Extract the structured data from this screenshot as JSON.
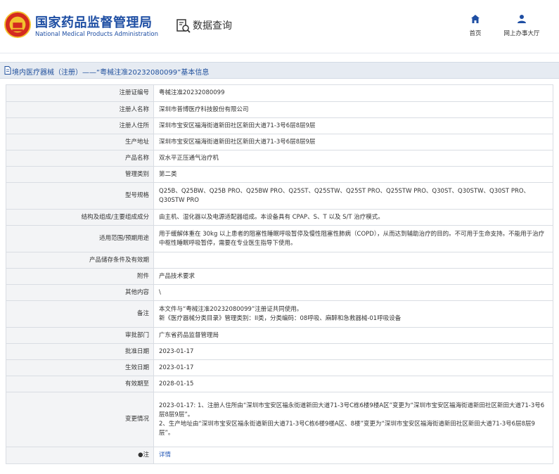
{
  "header": {
    "site_title_cn": "国家药品监督管理局",
    "site_title_en": "National Medical Products Administration",
    "query_title": "数据查询",
    "nav": [
      {
        "label": "首页",
        "icon": "home-icon"
      },
      {
        "label": "网上办事大厅",
        "icon": "user-icon"
      }
    ]
  },
  "page_title": "境内医疗器械（注册）——“粤械注准20232080099”基本信息",
  "rows": [
    {
      "label": "注册证编号",
      "value": "粤械注准20232080099"
    },
    {
      "label": "注册人名称",
      "value": "深圳市普博医疗科技股份有限公司"
    },
    {
      "label": "注册人住所",
      "value": "深圳市宝安区福海街道新田社区新田大道71-3号6层8层9层"
    },
    {
      "label": "生产地址",
      "value": "深圳市宝安区福海街道新田社区新田大道71-3号6层8层9层"
    },
    {
      "label": "产品名称",
      "value": "双水平正压通气治疗机"
    },
    {
      "label": "管理类别",
      "value": "第二类"
    },
    {
      "label": "型号规格",
      "value": "Q25B、Q25BW、Q25B PRO、Q25BW PRO、Q25ST、Q25STW、Q25ST PRO、Q25STW PRO、Q30ST、Q30STW、Q30ST PRO、Q30STW PRO"
    },
    {
      "label": "结构及组成/主要组成成分",
      "value": "由主机、湿化器以及电源适配器组成。本设备具有 CPAP、S、T 以及 S/T 治疗模式。"
    },
    {
      "label": "适用范围/预期用途",
      "value": "用于缓解体重在 30kg 以上患者的阻塞性睡眠呼吸暂停及慢性阻塞性肺病（COPD），从而达到辅助治疗的目的。不可用于生命支持。不能用于治疗中枢性睡眠呼吸暂停，需要在专业医生指导下使用。"
    },
    {
      "label": "产品储存条件及有效期",
      "value": ""
    },
    {
      "label": "附件",
      "value": "产品技术要求"
    },
    {
      "label": "其他内容",
      "value": "\\"
    },
    {
      "label": "备注",
      "value": "本文件与“粤械注准20232080099”注册证共同使用。\n新《医疗器械分类目录》管理类别：II类，分类编码：08呼吸、麻醉和急救器械-01呼吸设备"
    },
    {
      "label": "审批部门",
      "value": "广东省药品监督管理局"
    },
    {
      "label": "批准日期",
      "value": "2023-01-17"
    },
    {
      "label": "生效日期",
      "value": "2023-01-17"
    },
    {
      "label": "有效期至",
      "value": "2028-01-15"
    },
    {
      "label": "变更情况",
      "value": "2023-01-17: 1、注册人住所由“深圳市宝安区福永街道新田大道71-3号C栋6楼9楼A区”变更为“深圳市宝安区福海街道新田社区新田大道71-3号6层8层9层”。\n2、生产地址由“深圳市宝安区福永街道新田大道71-3号C栋6楼9楼A区、8楼”变更为“深圳市宝安区福海街道新田社区新田大道71-3号6层8层9层”。"
    },
    {
      "label": "●注",
      "value": "详情",
      "is_link": true
    }
  ],
  "colors": {
    "brand_blue": "#1e4ea3",
    "link_blue": "#2a5cb8",
    "label_bg": "#f3f4f6",
    "title_bar_bg": "#e6ebf2",
    "emblem_red": "#d42a1f",
    "emblem_gold": "#f2c12e"
  }
}
